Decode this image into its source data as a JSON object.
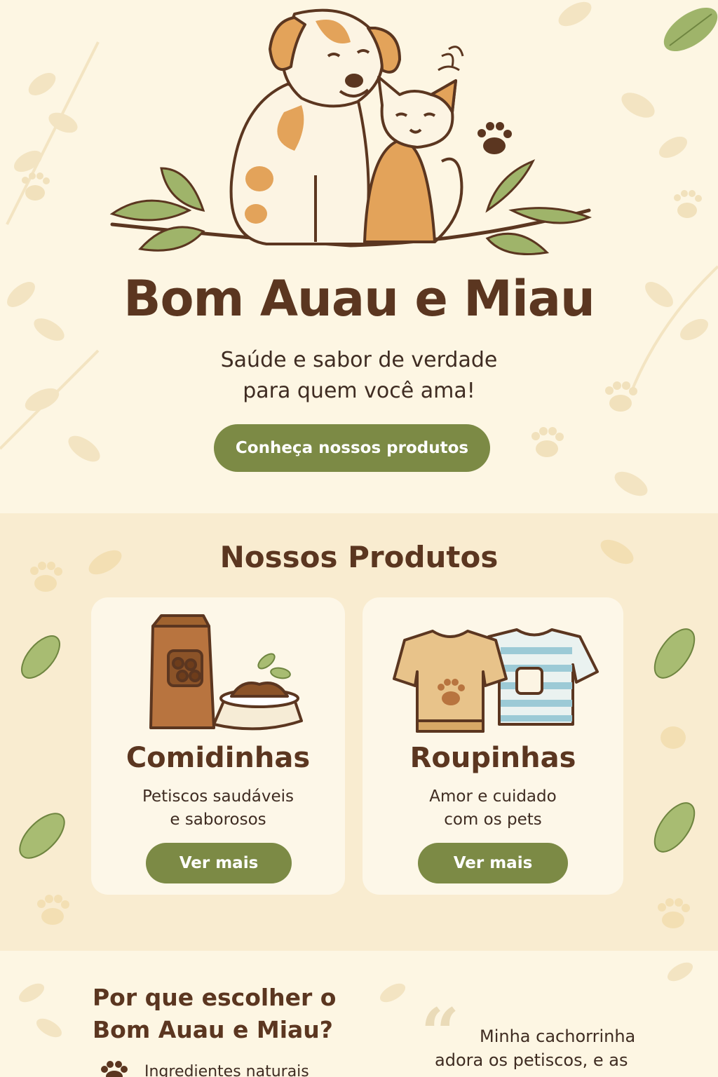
{
  "hero": {
    "brand_name": "Bom Auau e Miau",
    "tagline_line1": "Saúde e sabor de verdade",
    "tagline_line2": "para quem você ama!",
    "cta_label": "Conheça nossos produtos"
  },
  "products": {
    "section_title": "Nossos Produtos",
    "items": [
      {
        "title": "Comidinhas",
        "desc_line1": "Petiscos saudáveis",
        "desc_line2": "e saborosos",
        "button": "Ver mais",
        "icon": "pet-food-icon"
      },
      {
        "title": "Roupinhas",
        "desc_line1": "Amor e cuidado",
        "desc_line2": "com os pets",
        "button": "Ver mais",
        "icon": "pet-clothes-icon"
      }
    ]
  },
  "why": {
    "title_line1": "Por que escolher o",
    "title_line2": "Bom Auau e Miau?",
    "item1": "Ingredientes naturais",
    "testimonial_line1": "Minha cachorrinha",
    "testimonial_line2": "adora os petiscos, e as"
  },
  "colors": {
    "brown": "#5b3620",
    "green": "#7c8a45",
    "cream": "#fdf6e3",
    "beige": "#f9ecd0",
    "orange": "#e3a35a"
  }
}
